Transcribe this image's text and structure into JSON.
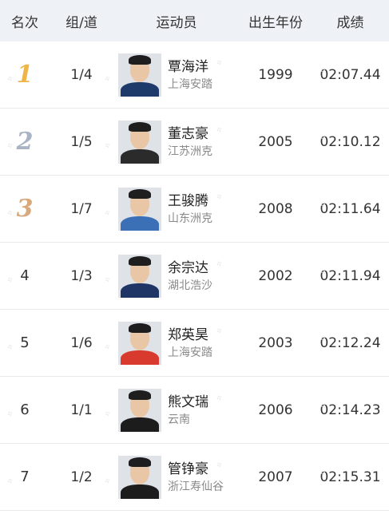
{
  "header": {
    "rank": "名次",
    "lane": "组/道",
    "athlete": "运动员",
    "birth_year": "出生年份",
    "result": "成绩"
  },
  "colors": {
    "gold": "#f0b548",
    "silver": "#a8b4c4",
    "bronze": "#d9a97e",
    "header_bg": "#eef1f6"
  },
  "rows": [
    {
      "rank": "1",
      "lane": "1/4",
      "name": "覃海洋",
      "team": "上海安踏",
      "year": "1999",
      "time": "02:07.44",
      "shirt": "#1d3a6b"
    },
    {
      "rank": "2",
      "lane": "1/5",
      "name": "董志豪",
      "team": "江苏洲克",
      "year": "2005",
      "time": "02:10.12",
      "shirt": "#2b2b2b"
    },
    {
      "rank": "3",
      "lane": "1/7",
      "name": "王骏腾",
      "team": "山东洲克",
      "year": "2008",
      "time": "02:11.64",
      "shirt": "#3b6fb6"
    },
    {
      "rank": "4",
      "lane": "1/3",
      "name": "余宗达",
      "team": "湖北浩沙",
      "year": "2002",
      "time": "02:11.94",
      "shirt": "#1f3566"
    },
    {
      "rank": "5",
      "lane": "1/6",
      "name": "郑英昊",
      "team": "上海安踏",
      "year": "2003",
      "time": "02:12.24",
      "shirt": "#d83a2e"
    },
    {
      "rank": "6",
      "lane": "1/1",
      "name": "熊文瑞",
      "team": "云南",
      "year": "2006",
      "time": "02:14.23",
      "shirt": "#1c1c1c"
    },
    {
      "rank": "7",
      "lane": "1/2",
      "name": "管铮豪",
      "team": "浙江寿仙谷",
      "year": "2007",
      "time": "02:15.31",
      "shirt": "#1c1c1c"
    }
  ]
}
